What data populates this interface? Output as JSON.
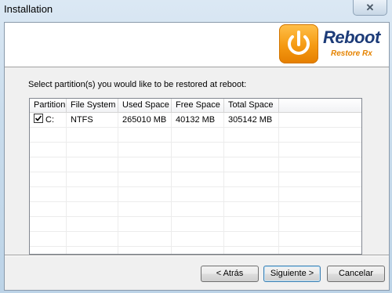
{
  "window": {
    "title": "Installation",
    "close_glyph": "✕"
  },
  "logo": {
    "title": "Reboot",
    "subtitle": "Restore Rx",
    "icon": "power-icon",
    "accent": "#f59a12",
    "brand_color": "#1c3b78"
  },
  "instruction": "Select partition(s) you would like to be restored at reboot:",
  "table": {
    "columns": [
      "Partition",
      "File System",
      "Used Space",
      "Free Space",
      "Total Space"
    ],
    "rows": [
      {
        "checked": true,
        "partition": "C:",
        "file_system": "NTFS",
        "used": "265010 MB",
        "free": "40132 MB",
        "total": "305142 MB"
      }
    ]
  },
  "buttons": {
    "back": "< Atrás",
    "next": "Siguiente >",
    "cancel": "Cancelar"
  }
}
